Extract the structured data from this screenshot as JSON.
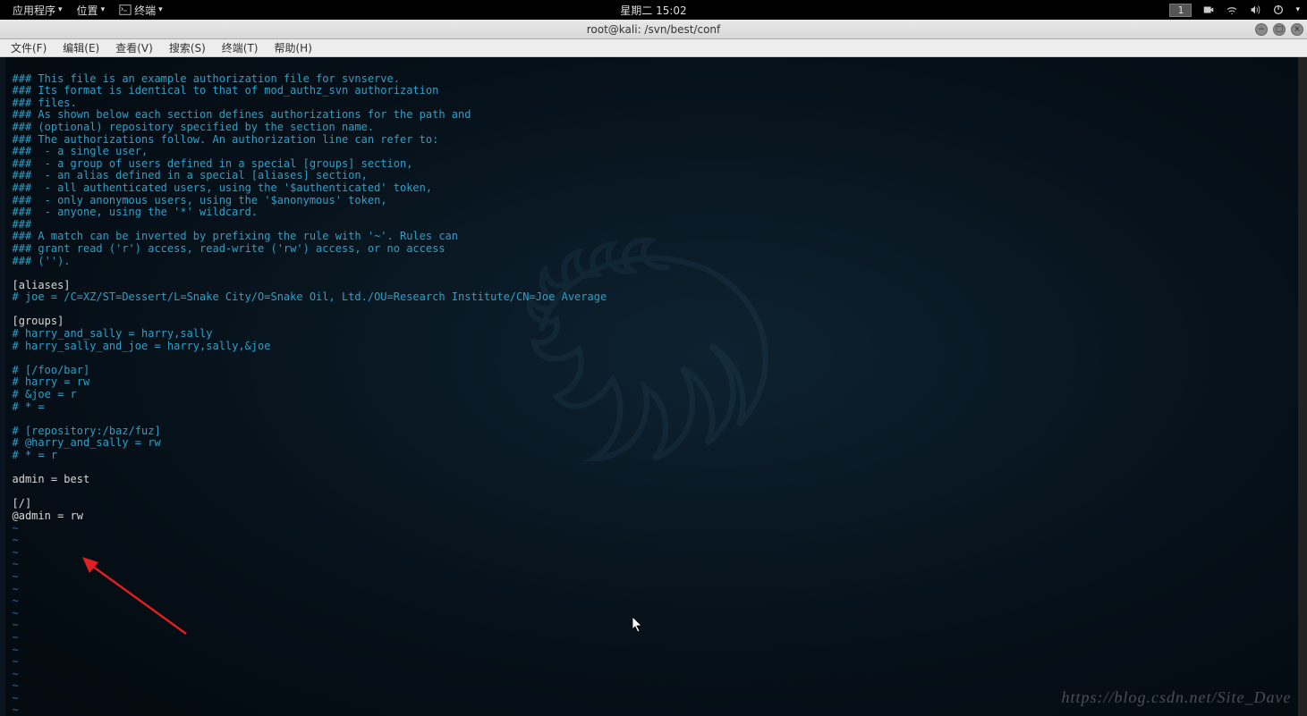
{
  "panel": {
    "apps": "应用程序",
    "places": "位置",
    "terminal": "终端",
    "clock": "星期二 15:02",
    "workspace": "1"
  },
  "titlebar": {
    "title": "root@kali: /svn/best/conf"
  },
  "menubar": {
    "file": "文件(F)",
    "edit": "编辑(E)",
    "view": "查看(V)",
    "search": "搜索(S)",
    "terminal": "终端(T)",
    "help": "帮助(H)"
  },
  "file_content": {
    "l1": "### This file is an example authorization file for svnserve.",
    "l2": "### Its format is identical to that of mod_authz_svn authorization",
    "l3": "### files.",
    "l4": "### As shown below each section defines authorizations for the path and",
    "l5": "### (optional) repository specified by the section name.",
    "l6": "### The authorizations follow. An authorization line can refer to:",
    "l7": "###  - a single user,",
    "l8": "###  - a group of users defined in a special [groups] section,",
    "l9": "###  - an alias defined in a special [aliases] section,",
    "l10": "###  - all authenticated users, using the '$authenticated' token,",
    "l11": "###  - only anonymous users, using the '$anonymous' token,",
    "l12": "###  - anyone, using the '*' wildcard.",
    "l13": "###",
    "l14": "### A match can be inverted by prefixing the rule with '~'. Rules can",
    "l15": "### grant read ('r') access, read-write ('rw') access, or no access",
    "l16": "### ('').",
    "aliases_hdr": "[aliases]",
    "aliases_l1": "# joe = /C=XZ/ST=Dessert/L=Snake City/O=Snake Oil, Ltd./OU=Research Institute/CN=Joe Average",
    "groups_hdr": "[groups]",
    "groups_l1": "# harry_and_sally = harry,sally",
    "groups_l2": "# harry_sally_and_joe = harry,sally,&joe",
    "foo_l1": "# [/foo/bar]",
    "foo_l2": "# harry = rw",
    "foo_l3": "# &joe = r",
    "foo_l4": "# * =",
    "repo_l1": "# [repository:/baz/fuz]",
    "repo_l2": "# @harry_and_sally = rw",
    "repo_l3": "# * = r",
    "admin": "admin = best",
    "root_hdr": "[/]",
    "root_l1": "@admin = rw",
    "tilde": "~"
  },
  "watermark": "https://blog.csdn.net/Site_Dave"
}
